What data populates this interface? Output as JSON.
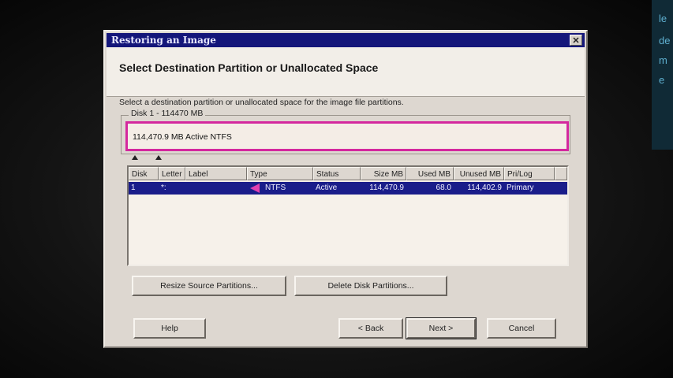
{
  "window": {
    "title": "Restoring an Image"
  },
  "header": {
    "title": "Select Destination Partition or Unallocated Space"
  },
  "instruction": "Select a destination partition or unallocated space for the image file partitions.",
  "disk_group": {
    "label": "Disk 1 - 114470 MB",
    "partition_text": "114,470.9 MB Active NTFS"
  },
  "table": {
    "columns": [
      "Disk",
      "Letter",
      "Label",
      "Type",
      "Status",
      "Size MB",
      "Used MB",
      "Unused MB",
      "Pri/Log"
    ],
    "rows": [
      {
        "disk": "1",
        "letter": "*:",
        "label": "",
        "type": "NTFS",
        "status": "Active",
        "size": "114,470.9",
        "used": "68.0",
        "unused": "114,402.9",
        "prilog": "Primary"
      }
    ]
  },
  "buttons": {
    "resize": "Resize Source Partitions...",
    "delete": "Delete Disk Partitions...",
    "help": "Help",
    "back": "< Back",
    "next": "Next >",
    "cancel": "Cancel"
  },
  "background_text": [
    "le",
    "de",
    "m",
    "e"
  ],
  "colors": {
    "titlebar": "#14167a",
    "selection": "#1a1d8a",
    "partition_border": "#d4289e",
    "dialog_face": "#ddd7d0"
  },
  "icons": {
    "close": "close-icon",
    "partition_type": "pink-triangle-icon"
  }
}
